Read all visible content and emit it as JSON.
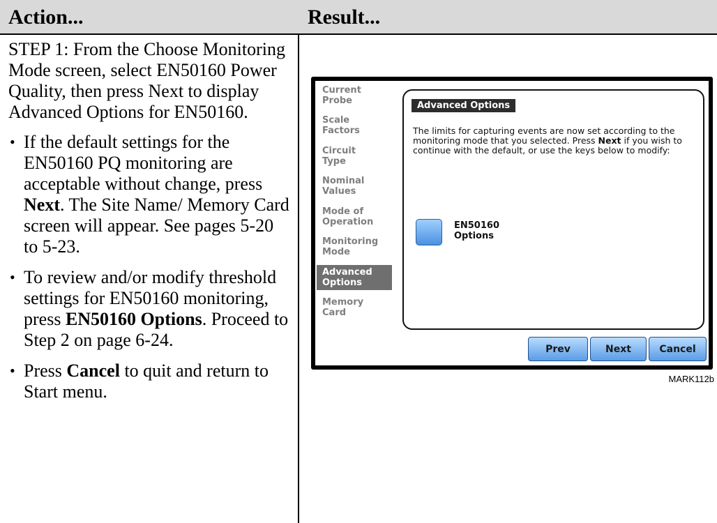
{
  "table": {
    "header_action": "Action...",
    "header_result": "Result..."
  },
  "action": {
    "step": "STEP 1: From the Choose Monitoring Mode screen, select EN50160 Power Quality, then press Next to display Advanced Options for EN50160.",
    "bullets": [
      {
        "pre": "If the default settings for the EN50160 PQ monitoring are acceptable without change, press ",
        "bold": "Next",
        "post": ". The Site Name/ Memory Card screen will appear. See pages 5-20 to 5-23."
      },
      {
        "pre": "To review and/or modify threshold settings for EN50160 monitoring, press ",
        "bold": "EN50160 Options",
        "post": ". Proceed to Step 2 on page 6-24."
      },
      {
        "pre": "Press ",
        "bold": "Cancel",
        "post": " to quit and return to Start menu."
      }
    ]
  },
  "device": {
    "sidebar": [
      {
        "line1": "Current",
        "line2": "Probe"
      },
      {
        "line1": "Scale",
        "line2": "Factors"
      },
      {
        "line1": "Circuit",
        "line2": "Type"
      },
      {
        "line1": "Nominal",
        "line2": "Values"
      },
      {
        "line1": "Mode of",
        "line2": "Operation"
      },
      {
        "line1": "Monitoring",
        "line2": "Mode"
      },
      {
        "line1": "Advanced",
        "line2": "Options"
      },
      {
        "line1": "Memory",
        "line2": "Card"
      }
    ],
    "panel_title": "Advanced Options",
    "panel_text_pre": "The limits for capturing events are now set according to the monitoring mode that you selected. Press ",
    "panel_text_bold": "Next",
    "panel_text_post": " if you wish to continue with the default, or use the keys below to modify:",
    "option_line1": "EN50160",
    "option_line2": "Options",
    "buttons": {
      "prev": "Prev",
      "next": "Next",
      "cancel": "Cancel"
    }
  },
  "figure_label": "MARK112b"
}
